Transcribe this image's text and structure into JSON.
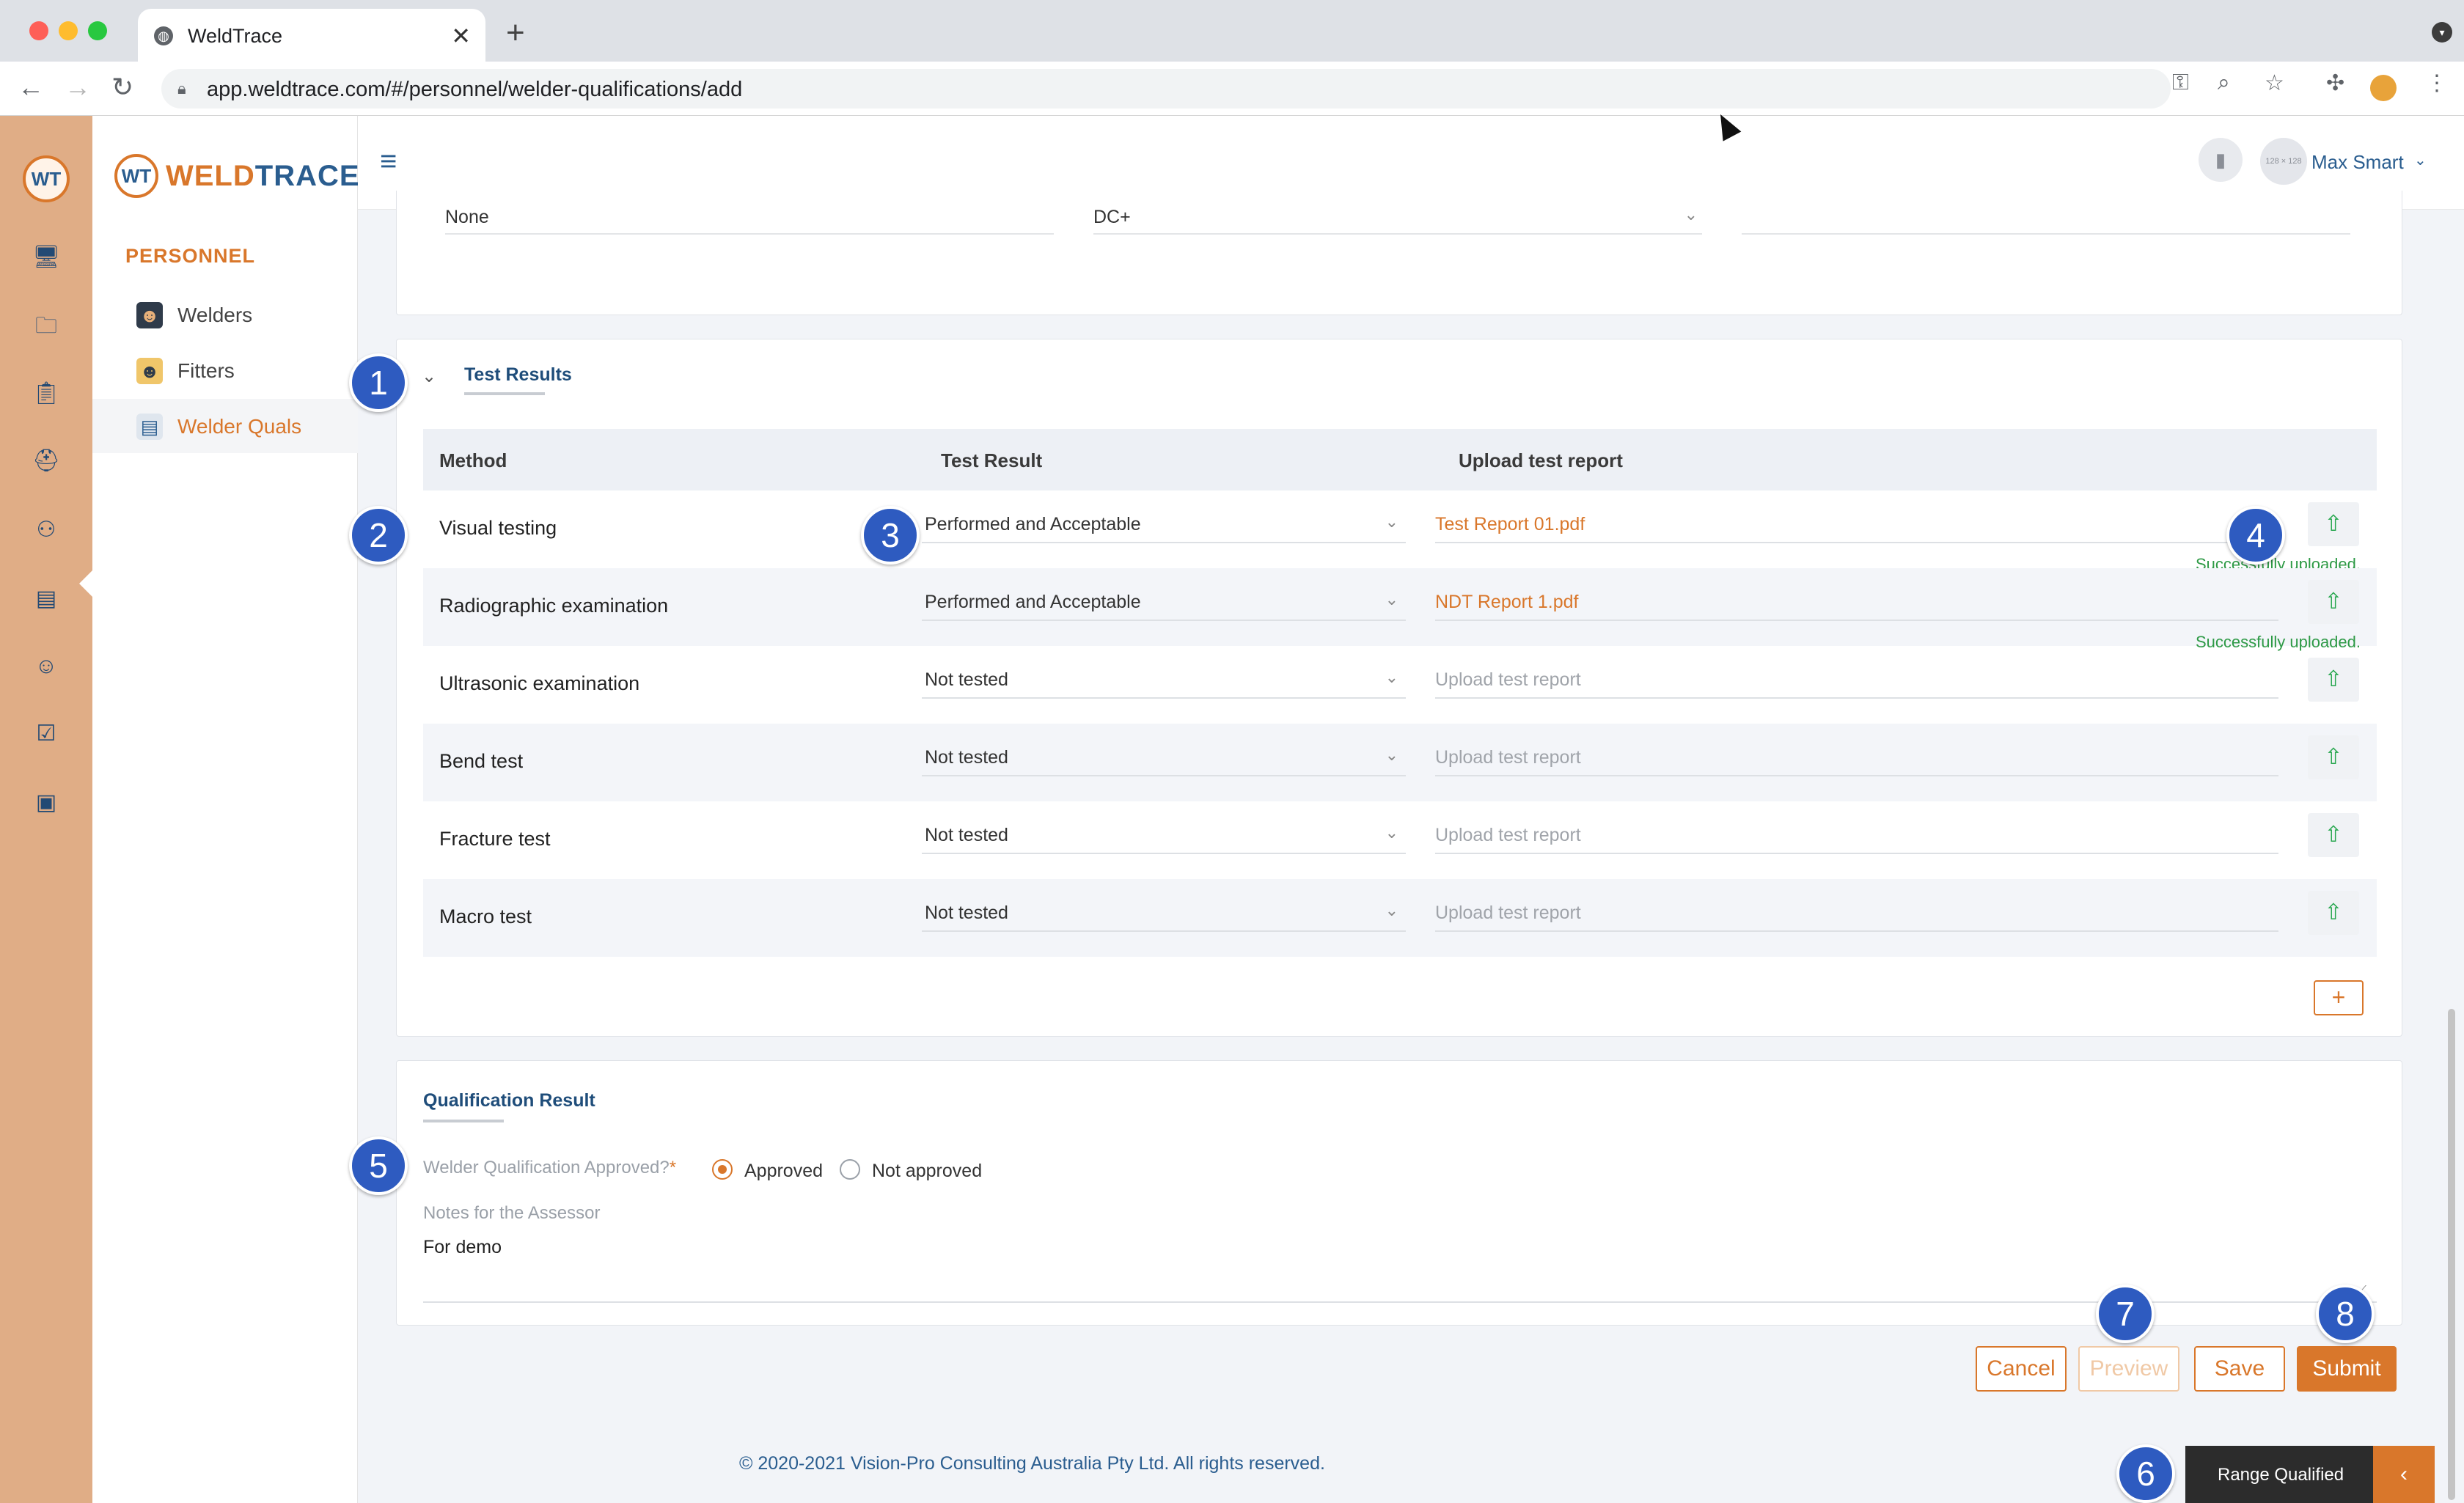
{
  "browser": {
    "tab_title": "WeldTrace",
    "url": "app.weldtrace.com/#/personnel/welder-qualifications/add",
    "new_tab": "+",
    "close_tab": "✕"
  },
  "rail": {
    "logo_text": "WT",
    "icons": [
      "monitor-icon",
      "folder-settings-icon",
      "clipboard-gear-icon",
      "welder-mask-icon",
      "org-chart-icon",
      "workstation-icon",
      "team-icon",
      "checklist-clock-icon",
      "badge-icon"
    ]
  },
  "sidenav": {
    "brand_mark": "WT",
    "brand_weld": "WELD",
    "brand_trace": "TRACE",
    "section": "PERSONNEL",
    "items": [
      {
        "label": "Welders",
        "icon": "welder-icon"
      },
      {
        "label": "Fitters",
        "icon": "fitter-icon"
      },
      {
        "label": "Welder Quals",
        "icon": "certificate-icon",
        "active": true
      }
    ]
  },
  "header": {
    "avatar_text": "128 × 128",
    "user_name": "Max Smart"
  },
  "top_fields": {
    "field1": "None",
    "field2": "DC+"
  },
  "test_results": {
    "title": "Test Results",
    "columns": [
      "Method",
      "Test Result",
      "Upload test report"
    ],
    "rows": [
      {
        "method": "Visual testing",
        "result": "Performed and Acceptable",
        "file": "Test Report 01.pdf",
        "status": "Successfully uploaded."
      },
      {
        "method": "Radiographic examination",
        "result": "Performed and Acceptable",
        "file": "NDT Report 1.pdf",
        "status": "Successfully uploaded."
      },
      {
        "method": "Ultrasonic examination",
        "result": "Not tested",
        "file": "Upload test report",
        "status": ""
      },
      {
        "method": "Bend test",
        "result": "Not tested",
        "file": "Upload test report",
        "status": ""
      },
      {
        "method": "Fracture test",
        "result": "Not tested",
        "file": "Upload test report",
        "status": ""
      },
      {
        "method": "Macro test",
        "result": "Not tested",
        "file": "Upload test report",
        "status": ""
      }
    ],
    "add_row": "+"
  },
  "qualification": {
    "title": "Qualification Result",
    "approved_question": "Welder Qualification Approved?",
    "required_mark": "*",
    "option_approved": "Approved",
    "option_not_approved": "Not approved",
    "selected": "Approved",
    "notes_label": "Notes for the Assessor",
    "notes_value": "For demo"
  },
  "actions": {
    "cancel": "Cancel",
    "preview": "Preview",
    "save": "Save",
    "submit": "Submit"
  },
  "footer": {
    "copyright": "© 2020-2021 Vision-Pro Consulting Australia Pty Ltd. All rights reserved."
  },
  "range_panel": {
    "label": "Range Qualified",
    "toggle": "‹"
  },
  "badges": [
    "1",
    "2",
    "3",
    "4",
    "5",
    "6",
    "7",
    "8"
  ],
  "colors": {
    "accent": "#d9772b",
    "brand_blue": "#2a5d8f",
    "rail": "#e0ad86",
    "badge": "#2e5bc0",
    "success": "#2e9a46"
  }
}
